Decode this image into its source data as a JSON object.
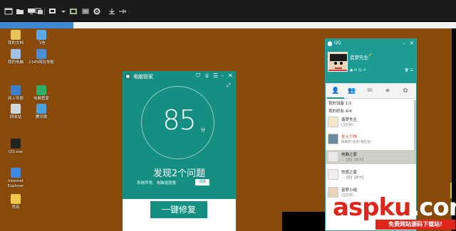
{
  "toolbar": {
    "buttons": [
      "new-window-icon",
      "folder-icon",
      "monitor-icon",
      "copy-windows-icon",
      "display-icon",
      "film-icon",
      "gear-icon",
      "download-icon",
      "usb-icon"
    ]
  },
  "desktop": {
    "icons": [
      {
        "label": "我的文档",
        "icon": "documents-icon",
        "color": "#e8c35a"
      },
      {
        "label": "飞信",
        "icon": "fetion-icon",
        "color": "#5aa9e8"
      },
      {
        "label": "我的电脑",
        "icon": "computer-icon",
        "color": "#9fc3e6"
      },
      {
        "label": "2345网址导航",
        "icon": "browser-icon",
        "color": "#4c8fd9"
      },
      {
        "label": "网上邻居",
        "icon": "network-icon",
        "color": "#3d7fd1"
      },
      {
        "label": "电脑管家",
        "icon": "pcmanager-icon",
        "color": "#2fb06a"
      },
      {
        "label": "回收站",
        "icon": "recycle-bin-icon",
        "color": "#cfd8dc"
      },
      {
        "label": "腾讯微",
        "icon": "tencent-icon",
        "color": "#4aa3df"
      },
      {
        "label": "QQ.exe",
        "icon": "qq-icon",
        "color": "#222222"
      },
      {
        "label": "Internet Explorer",
        "icon": "ie-icon",
        "color": "#3d8be0"
      },
      {
        "label": "常用",
        "icon": "folder-icon",
        "color": "#f0c64d"
      }
    ]
  },
  "pc_manager": {
    "title": "电脑管家",
    "score": "85",
    "score_unit": "分",
    "issues": "发现2个问题",
    "subtitle": "系统异常、电脑速度慢",
    "detail_label": "详情",
    "fix_label": "一键修复",
    "accent": "#168f83"
  },
  "qq": {
    "title": "QQ",
    "nickname": "造梦先生",
    "groups": [
      {
        "label": "我的设备 1/1"
      },
      {
        "label": "我的好友 4/4"
      }
    ],
    "contacts": [
      {
        "name": "造梦先生",
        "signature": "[正在听] ..."
      },
      {
        "name": "圣火少帅",
        "signature": "快来玩“农场”抢红包！"
      },
      {
        "name": "电脑之家",
        "signature": "…【后】【原文】"
      },
      {
        "name": "伤感之家",
        "signature": "…【后】【原文】"
      },
      {
        "name": "苗梦小组",
        "signature": "[正在听] ..."
      }
    ],
    "accent": "#1e9b94"
  },
  "watermark": {
    "main_a": "aspku",
    "main_b": ".com",
    "sub": "免费网站源码下载站!"
  }
}
